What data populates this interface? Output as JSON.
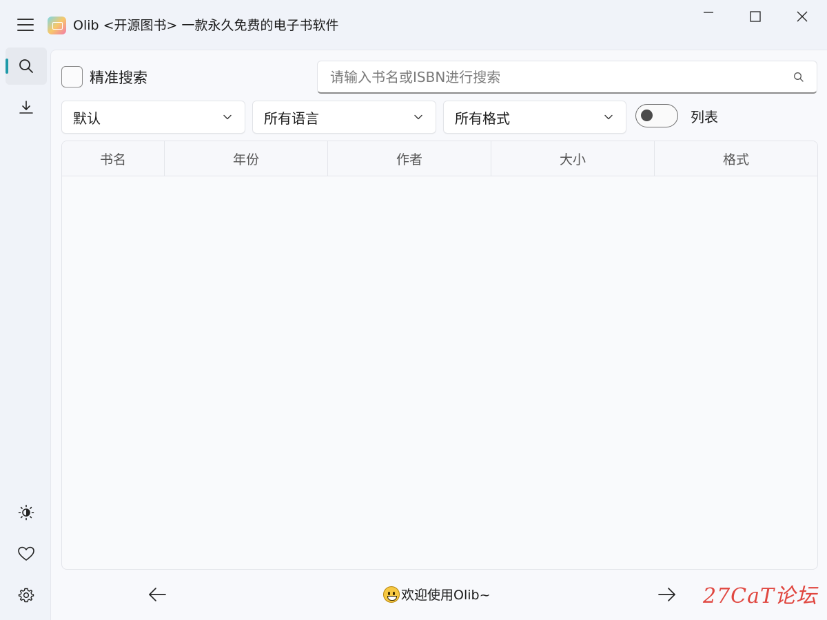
{
  "window": {
    "title": "Olib <开源图书> 一款永久免费的电子书软件"
  },
  "sidebar": {
    "items": [
      {
        "name": "search",
        "icon": "search-icon",
        "active": true
      },
      {
        "name": "download",
        "icon": "download-icon",
        "active": false
      },
      {
        "name": "theme",
        "icon": "brightness-icon",
        "active": false
      },
      {
        "name": "favorite",
        "icon": "heart-icon",
        "active": false
      },
      {
        "name": "settings",
        "icon": "gear-icon",
        "active": false
      }
    ],
    "accent": "#1f9aa9"
  },
  "search": {
    "exact_label": "精准搜索",
    "exact_checked": false,
    "placeholder": "请输入书名或ISBN进行搜索",
    "value": ""
  },
  "filters": {
    "sort": "默认",
    "language": "所有语言",
    "format": "所有格式",
    "view_toggle_label": "列表",
    "view_toggle_on": false
  },
  "table": {
    "columns": [
      "书名",
      "年份",
      "作者",
      "大小",
      "格式"
    ],
    "rows": []
  },
  "footer": {
    "status": "欢迎使用Olib~",
    "emoji": "grinning-face-icon"
  },
  "watermark": "27CaT论坛"
}
